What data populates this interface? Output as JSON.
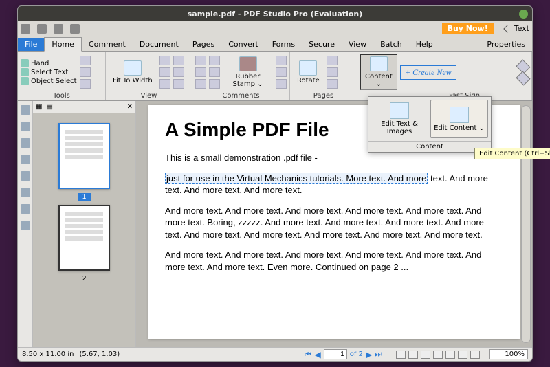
{
  "title": "sample.pdf - PDF Studio Pro (Evaluation)",
  "qat": {
    "buynow": "Buy Now!",
    "tab_label": "Text"
  },
  "tabs": {
    "file": "File",
    "home": "Home",
    "comment": "Comment",
    "document": "Document",
    "pages": "Pages",
    "convert": "Convert",
    "forms": "Forms",
    "secure": "Secure",
    "view": "View",
    "batch": "Batch",
    "help": "Help",
    "properties": "Properties"
  },
  "ribbon": {
    "tools": {
      "hand": "Hand",
      "select_text": "Select Text",
      "object_select": "Object Select",
      "label": "Tools"
    },
    "view": {
      "fit": "Fit To Width",
      "label": "View"
    },
    "comments": {
      "stamp": "Rubber Stamp ⌄",
      "label": "Comments"
    },
    "pages": {
      "rotate": "Rotate",
      "label": "Pages"
    },
    "content": {
      "btn": "Content ⌄"
    },
    "fastsign": {
      "create": "+ Create New",
      "label": "Fast Sign"
    }
  },
  "popup": {
    "edit_text": "Edit Text & Images",
    "edit_content": "Edit Content ⌄",
    "label": "Content"
  },
  "tooltip": "Edit Content  (Ctrl+Shift+E)",
  "thumbs": {
    "p1": "1",
    "p2": "2"
  },
  "document": {
    "title": "A Simple PDF File",
    "intro": "This is a small demonstration .pdf file -",
    "sel": "just for use in the Virtual Mechanics tutorials. More text. And more",
    "sel_after": "text. And more text. And more text. And more text.",
    "para2": "And more text. And more text. And more text. And more text. And more text. And more text. Boring, zzzzz. And more text. And more text. And more text. And more text. And more text. And more text. And more text. And more text. And more text.",
    "para3": "And more text. And more text. And more text. And more text. And more text. And more text. And more text. Even more. Continued on page 2 ..."
  },
  "status": {
    "dims": "8.50 x 11.00 in",
    "coords": "(5.67, 1.03)",
    "of_pages": "of 2",
    "page_value": "1",
    "zoom": "100%"
  }
}
